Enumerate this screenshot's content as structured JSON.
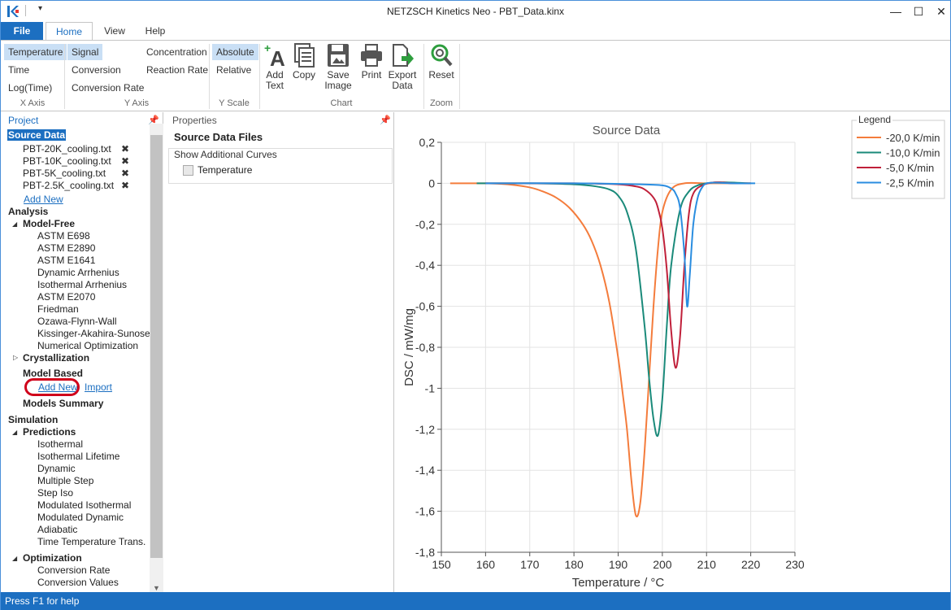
{
  "window": {
    "title": "NETZSCH Kinetics Neo - PBT_Data.kinx",
    "minimize": "—",
    "maximize": "☐",
    "close": "✕"
  },
  "tabs": {
    "file": "File",
    "home": "Home",
    "view": "View",
    "help": "Help"
  },
  "ribbon": {
    "x_axis": {
      "options": [
        "Temperature",
        "Time",
        "Log(Time)"
      ],
      "selected": "Temperature",
      "label": "X Axis"
    },
    "y_axis": {
      "col1": [
        "Signal",
        "Conversion",
        "Conversion Rate"
      ],
      "col2": [
        "Concentration",
        "Reaction Rate"
      ],
      "selected": "Signal",
      "label": "Y Axis"
    },
    "y_scale": {
      "options": [
        "Absolute",
        "Relative"
      ],
      "selected": "Absolute",
      "label": "Y Scale"
    },
    "chart": {
      "add_text_1": "Add",
      "add_text_2": "Text",
      "copy": "Copy",
      "save_1": "Save",
      "save_2": "Image",
      "print": "Print",
      "export_1": "Export",
      "export_2": "Data",
      "label": "Chart"
    },
    "zoom": {
      "reset": "Reset",
      "label": "Zoom"
    },
    "accent": "#1c6fc1"
  },
  "project": {
    "header": "Project",
    "source_data": "Source Data",
    "files": [
      "PBT-20K_cooling.txt",
      "PBT-10K_cooling.txt",
      "PBT-5K_cooling.txt",
      "PBT-2.5K_cooling.txt"
    ],
    "add_new": "Add New",
    "analysis": "Analysis",
    "model_free": "Model-Free",
    "model_free_items": [
      "ASTM E698",
      "ASTM E2890",
      "ASTM E1641",
      "Dynamic Arrhenius",
      "Isothermal Arrhenius",
      "ASTM E2070",
      "Friedman",
      "Ozawa-Flynn-Wall",
      "Kissinger-Akahira-Sunose",
      "Numerical Optimization"
    ],
    "crystallization": "Crystallization",
    "model_based": "Model Based",
    "model_based_add": "Add New",
    "model_based_import": "Import",
    "models_summary": "Models Summary",
    "simulation": "Simulation",
    "predictions": "Predictions",
    "prediction_items": [
      "Isothermal",
      "Isothermal Lifetime",
      "Dynamic",
      "Multiple Step",
      "Step Iso",
      "Modulated Isothermal",
      "Modulated Dynamic",
      "Adiabatic",
      "Time Temperature Trans."
    ],
    "optimization": "Optimization",
    "optimization_items": [
      "Conversion Rate",
      "Conversion Values"
    ]
  },
  "properties": {
    "header": "Properties",
    "title": "Source Data Files",
    "group_label": "Show Additional Curves",
    "checkbox_label": "Temperature",
    "checked": false
  },
  "statusbar": {
    "text": "Press F1 for help"
  },
  "chart_data": {
    "type": "line",
    "title": "Source Data",
    "xlabel": "Temperature / °C",
    "ylabel": "DSC / mW/mg",
    "xlim": [
      150,
      230
    ],
    "ylim": [
      -1.8,
      0.2
    ],
    "xticks": [
      "150",
      "160",
      "170",
      "180",
      "190",
      "200",
      "210",
      "220",
      "230"
    ],
    "yticks": [
      "0,2",
      "0",
      "-0,2",
      "-0,4",
      "-0,6",
      "-0,8",
      "-1",
      "-1,2",
      "-1,4",
      "-1,6",
      "-1,8"
    ],
    "grid": true,
    "legend_title": "Legend",
    "legend_position": "top-right",
    "series": [
      {
        "name": "-20,0 K/min",
        "color": "#f47c3c",
        "x": [
          152,
          160,
          165,
          170,
          173,
          176,
          179,
          182,
          184,
          186,
          188,
          190,
          191,
          192,
          193,
          194,
          195,
          196,
          197,
          198,
          199,
          200,
          202,
          205,
          210,
          215,
          220
        ],
        "y": [
          0,
          0,
          -0.005,
          -0.02,
          -0.04,
          -0.07,
          -0.12,
          -0.2,
          -0.28,
          -0.4,
          -0.58,
          -0.85,
          -1.02,
          -1.2,
          -1.45,
          -1.62,
          -1.56,
          -1.3,
          -0.95,
          -0.6,
          -0.32,
          -0.14,
          -0.03,
          0,
          0,
          0,
          0
        ]
      },
      {
        "name": "-10,0 K/min",
        "color": "#1a8a7a",
        "x": [
          158,
          170,
          180,
          185,
          188,
          190,
          192,
          194,
          196,
          197,
          198,
          199,
          200,
          201,
          202,
          204,
          206,
          208,
          210,
          213,
          220
        ],
        "y": [
          0,
          0,
          -0.005,
          -0.015,
          -0.03,
          -0.06,
          -0.14,
          -0.32,
          -0.7,
          -0.95,
          -1.15,
          -1.23,
          -1.05,
          -0.7,
          -0.4,
          -0.13,
          -0.04,
          -0.01,
          0,
          0.005,
          0
        ]
      },
      {
        "name": "-5,0 K/min",
        "color": "#c0203a",
        "x": [
          160,
          180,
          190,
          194,
          196,
          198,
          199,
          200,
          201,
          202,
          203,
          204,
          205,
          206,
          207,
          209,
          212,
          216,
          220
        ],
        "y": [
          0,
          0,
          -0.005,
          -0.015,
          -0.03,
          -0.07,
          -0.12,
          -0.22,
          -0.42,
          -0.72,
          -0.9,
          -0.75,
          -0.4,
          -0.15,
          -0.05,
          -0.01,
          0.005,
          0,
          0
        ]
      },
      {
        "name": "-2,5 K/min",
        "color": "#2a8de0",
        "x": [
          160,
          180,
          195,
          200,
          202,
          203,
          204,
          205,
          205.6,
          206.2,
          207,
          208,
          209,
          210,
          212,
          216,
          221
        ],
        "y": [
          0,
          0,
          -0.005,
          -0.01,
          -0.025,
          -0.05,
          -0.12,
          -0.35,
          -0.6,
          -0.45,
          -0.2,
          -0.07,
          -0.02,
          0,
          0.003,
          0,
          0
        ]
      }
    ]
  }
}
